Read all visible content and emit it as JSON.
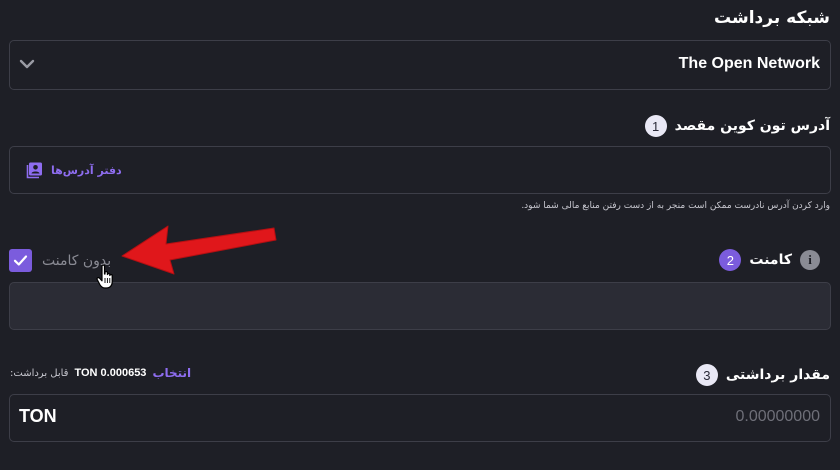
{
  "page": {
    "title": "شبکه برداشت"
  },
  "network": {
    "selected": "The Open Network",
    "icon": "chevron-down-icon"
  },
  "steps": [
    {
      "number": "1",
      "label": "آدرس تون کوین مقصد"
    },
    {
      "number": "2",
      "label": "کامنت"
    },
    {
      "number": "3",
      "label": "مقدار برداشتی"
    }
  ],
  "address": {
    "address_book_label": "دفتر آدرس‌ها",
    "address_book_icon": "address-book-icon",
    "warning": "وارد کردن آدرس نادرست ممکن است منجر به از دست رفتن منابع مالی شما شود."
  },
  "comment": {
    "info_icon_glyph": "i",
    "no_comment_label": "بدون کامنت",
    "no_comment_checked": true
  },
  "amount": {
    "withdrawable_caption": "قابل برداشت:",
    "withdrawable_value": "TON 0.000653",
    "select_label": "انتخاب",
    "unit": "TON",
    "placeholder": "0.00000000"
  },
  "colors": {
    "background": "#1e1f26",
    "accent": "#7b5cdd",
    "link": "#8e6df0",
    "border": "#3d3e48",
    "annotation_arrow": "#e0171b"
  }
}
